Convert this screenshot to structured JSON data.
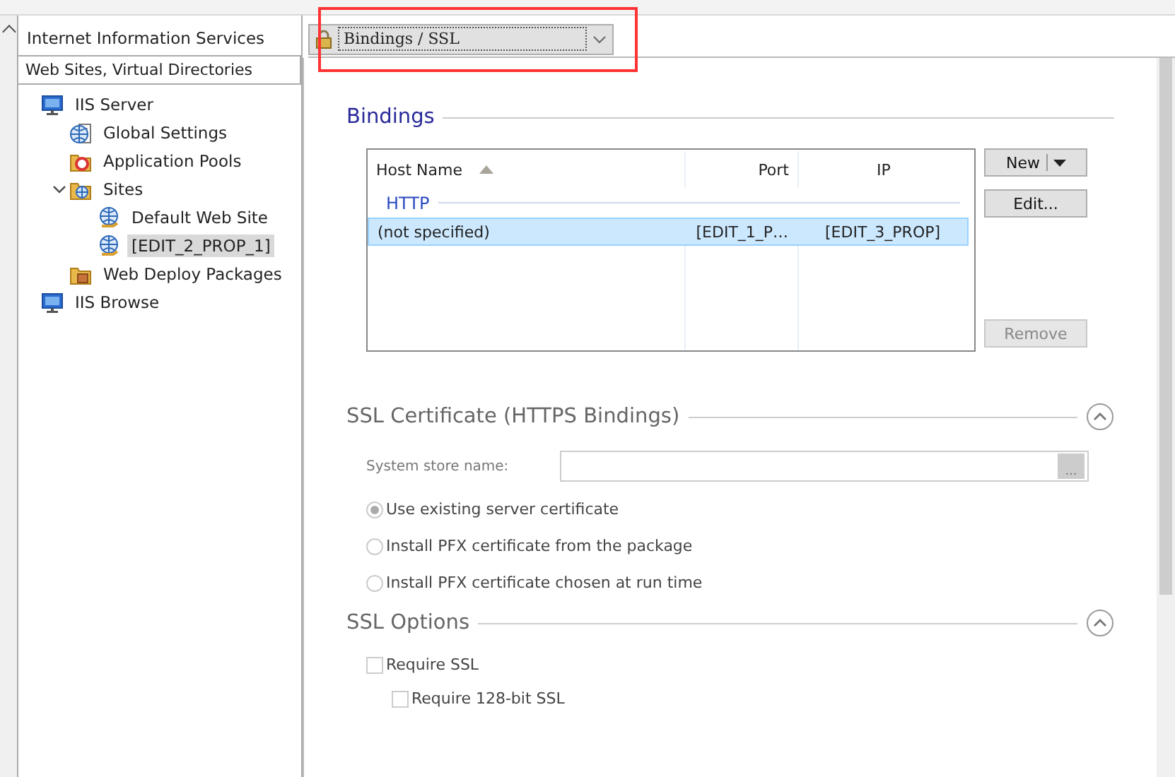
{
  "left_panel": {
    "title": "Internet Information Services",
    "subtitle": "Web Sites, Virtual Directories",
    "tree": [
      {
        "label": "IIS Server",
        "kind": "monitor",
        "selected": false,
        "children": [
          {
            "label": "Global Settings",
            "kind": "settings",
            "selected": false
          },
          {
            "label": "Application Pools",
            "kind": "pools",
            "selected": false
          },
          {
            "label": "Sites",
            "kind": "sites",
            "selected": false,
            "expanded": true,
            "children": [
              {
                "label": "Default Web Site",
                "kind": "site",
                "selected": false
              },
              {
                "label": "[EDIT_2_PROP_1]",
                "kind": "site",
                "selected": true
              }
            ]
          },
          {
            "label": "Web Deploy Packages",
            "kind": "packages",
            "selected": false
          }
        ]
      },
      {
        "label": "IIS Browse",
        "kind": "monitor",
        "selected": false
      }
    ]
  },
  "page_selector": {
    "value": "Bindings / SSL"
  },
  "bindings": {
    "title": "Bindings",
    "columns": [
      "Host Name",
      "Port",
      "IP"
    ],
    "group": "HTTP",
    "rows": [
      {
        "cells": [
          "(not specified)",
          "[EDIT_1_P…",
          "[EDIT_3_PROP]"
        ],
        "selected": true
      }
    ],
    "buttons": [
      {
        "label": "New",
        "kind": "split",
        "disabled": false
      },
      {
        "label": "Edit...",
        "kind": "plain",
        "disabled": false
      },
      {
        "label": "Remove",
        "kind": "plain",
        "disabled": true
      }
    ]
  },
  "ssl_certificate": {
    "title": "SSL Certificate (HTTPS Bindings)",
    "expanded": true,
    "store_label": "System store name:",
    "browse": "...",
    "options": [
      {
        "label": "Use existing server certificate",
        "selected": true
      },
      {
        "label": "Install PFX certificate from the package",
        "selected": false
      },
      {
        "label": "Install PFX certificate chosen at run time",
        "selected": false
      }
    ]
  },
  "ssl_options": {
    "title": "SSL Options",
    "expanded": true,
    "checks": [
      {
        "label": "Require SSL",
        "checked": false,
        "indented": false
      },
      {
        "label": "Require 128-bit SSL",
        "checked": false,
        "indented": true
      }
    ]
  }
}
